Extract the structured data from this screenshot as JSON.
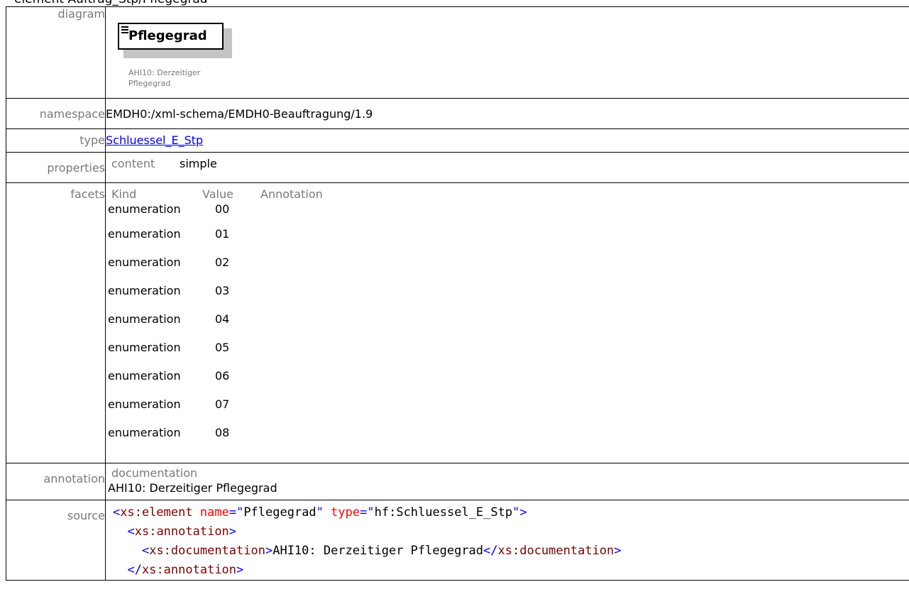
{
  "heading": "element Auftrag_Stp/Pflegegrad",
  "labels": {
    "diagram": "diagram",
    "namespace": "namespace",
    "type": "type",
    "properties": "properties",
    "facets": "facets",
    "annotation": "annotation",
    "source": "source"
  },
  "diagram": {
    "element_name": "Pflegegrad",
    "documentation_lines": [
      "AHI10: Derzeitiger",
      "Pflegegrad"
    ]
  },
  "namespace": "EMDH0:/xml-schema/EMDH0-Beauftragung/1.9",
  "type": {
    "name": "Schluessel_E_Stp"
  },
  "properties": {
    "key": "content",
    "value": "simple"
  },
  "facets": {
    "headers": [
      "Kind",
      "Value",
      "Annotation"
    ],
    "rows": [
      {
        "kind": "enumeration",
        "value": "00"
      },
      {
        "kind": "enumeration",
        "value": "01"
      },
      {
        "kind": "enumeration",
        "value": "02"
      },
      {
        "kind": "enumeration",
        "value": "03"
      },
      {
        "kind": "enumeration",
        "value": "04"
      },
      {
        "kind": "enumeration",
        "value": "05"
      },
      {
        "kind": "enumeration",
        "value": "06"
      },
      {
        "kind": "enumeration",
        "value": "07"
      },
      {
        "kind": "enumeration",
        "value": "08"
      }
    ]
  },
  "annotation": {
    "key": "documentation",
    "text": "AHI10: Derzeitiger Pflegegrad"
  },
  "source": {
    "line1": {
      "open": "<",
      "tag": "xs:element",
      "attr1": "name",
      "eq1": "=",
      "q": "\"",
      "val1": "Pflegegrad",
      "attr2": "type",
      "val2": "hf:Schluessel_E_Stp",
      "close": ">"
    },
    "line2": {
      "open": "<",
      "tag": "xs:annotation",
      "close": ">"
    },
    "line3": {
      "open": "<",
      "tag": "xs:documentation",
      "close": ">",
      "text": "AHI10: Derzeitiger Pflegegrad",
      "end_open": "</"
    },
    "line4": {
      "end_open": "</",
      "tag": "xs:annotation",
      "close": ">"
    }
  },
  "colors": {
    "label": "#7a7a7a",
    "link": "#0000ee",
    "tag": "#800000",
    "bracket": "#0000ff",
    "attribute": "#ff0000"
  }
}
